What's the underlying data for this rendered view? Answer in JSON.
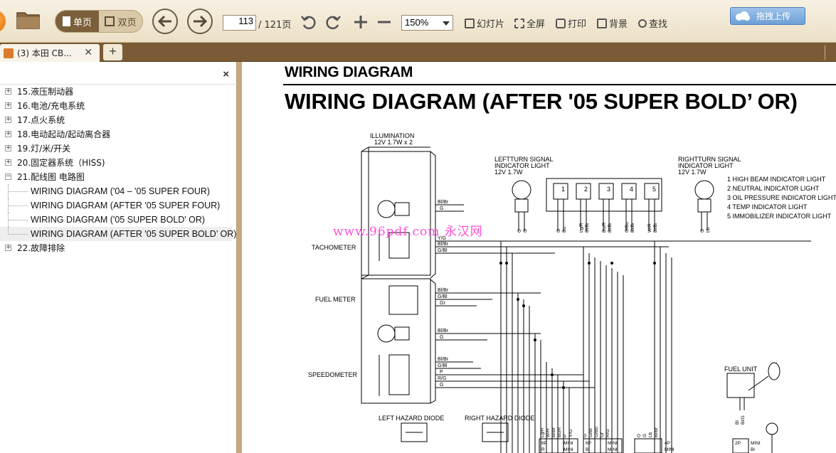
{
  "toolbar": {
    "view_single": "单页",
    "view_double": "双页",
    "page_current": "113",
    "page_total": "/ 121页",
    "zoom": "150%",
    "slideshow": "幻灯片",
    "fullscreen": "全屏",
    "print": "打印",
    "background": "背景",
    "search": "查找",
    "upload": "拖拽上传"
  },
  "tabs": [
    {
      "label": "(3) 本田 CB..."
    }
  ],
  "sidebar": {
    "close": "×",
    "items": [
      {
        "label": "15.液压制动器",
        "expander": "+"
      },
      {
        "label": "16.电池/充电系统",
        "expander": "+"
      },
      {
        "label": "17.点火系统",
        "expander": "+"
      },
      {
        "label": "18.电动起动/起动离合器",
        "expander": "+"
      },
      {
        "label": "19.灯/米/开关",
        "expander": "+"
      },
      {
        "label": "20.固定器系统（HISS)",
        "expander": "+"
      },
      {
        "label": "21.配线图 电路图",
        "expander": "−"
      },
      {
        "label": "WIRING DIAGRAM ('04 – '05 SUPER FOUR)"
      },
      {
        "label": "WIRING DIAGRAM (AFTER '05 SUPER FOUR)"
      },
      {
        "label": "WIRING DIAGRAM ('05 SUPER BOLD' OR)"
      },
      {
        "label": "WIRING DIAGRAM (AFTER '05 SUPER BOLD’ OR)"
      },
      {
        "label": "22.故障排除",
        "expander": "+"
      }
    ]
  },
  "document": {
    "header": "WIRING DIAGRAM",
    "title": "WIRING DIAGRAM (AFTER '05 SUPER BOLD’ OR)",
    "watermark": "www.96pdf.com 永汉网",
    "labels": {
      "illumination": "ILLUMINATION",
      "illumination_spec": "12V 1.7W x 2",
      "left_turn": "LEFTTURN SIGNAL",
      "left_turn_2": "INDICATOR LIGHT",
      "left_turn_spec": "12V 1.7W",
      "right_turn": "RIGHTTURN SIGNAL",
      "right_turn_2": "INDICATOR LIGHT",
      "right_turn_spec": "12V 1.7W",
      "tachometer": "TACHOMETER",
      "fuel_meter": "FUEL METER",
      "speedometer": "SPEEDOMETER",
      "left_hazard": "LEFT HAZARD DIODE",
      "right_hazard": "RIGHT HAZARD DIODE",
      "fuel_unit": "FUEL UNIT",
      "legend": [
        "1 HIGH BEAM INDICATOR LIGHT",
        "2 NEUTRAL INDICATOR LIGHT",
        "3 OIL PRESSURE INDICATOR LIGHT",
        "4 TEMP INDICATOR LIGHT",
        "5 IMMOBILIZER INDICATOR LIGHT"
      ],
      "indicator_numbers": [
        "1",
        "2",
        "3",
        "4",
        "5"
      ],
      "tach_wires": [
        "Bl/Br",
        "G",
        "Y/G",
        "Bl/Br",
        "G/Bl"
      ],
      "fuel_wires": [
        "Bl/Br",
        "G/Bl",
        "Gr",
        "Bl/Br",
        "G"
      ],
      "speedo_wires": [
        "Bl/Br",
        "G/Bl",
        "P",
        "R/G",
        "G"
      ],
      "top_wires": [
        "O",
        "G",
        "G",
        "Bu",
        "Lg/R",
        "Bl/Br",
        "Bu/R",
        "Bl/Br",
        "G/Bu",
        "Bl/Br",
        "W/R",
        "Bl/Br",
        "G",
        "Lb"
      ],
      "bottom_wires": [
        "Lg/R",
        "W/R",
        "Bl/Br",
        "Bu/R",
        "P",
        "Y/G",
        "G",
        "G/Bl",
        "G/Bu",
        "Gr",
        "R/G",
        "O",
        "G",
        "Lb",
        "Bl/Br",
        "Bl",
        "Bl/G"
      ],
      "connectors": [
        "6P",
        "MINI",
        "R",
        "MINI",
        "6P",
        "MINI",
        "Bl",
        "MINI",
        "4P",
        "MINI",
        "2P",
        "MINI",
        "Bl"
      ]
    }
  }
}
